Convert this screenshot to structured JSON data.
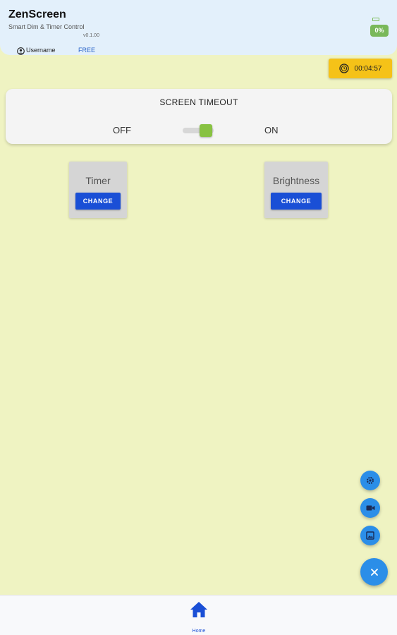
{
  "header": {
    "app_title": "ZenScreen",
    "subtitle": "Smart Dim & Timer Control",
    "version": "v0.1.00",
    "battery_percent": "0%",
    "username": "Username",
    "plan": "FREE"
  },
  "timer_chip": {
    "time": "00:04:57",
    "icon": "coin-icon"
  },
  "screen_timeout": {
    "title": "SCREEN TIMEOUT",
    "off_label": "OFF",
    "on_label": "ON",
    "enabled": true
  },
  "tiles": {
    "timer": {
      "label": "Timer",
      "button": "CHANGE"
    },
    "brightness": {
      "label": "Brightness",
      "button": "CHANGE"
    }
  },
  "fab": {
    "items": [
      "gear-icon",
      "video-camera-icon",
      "image-icon"
    ],
    "main_icon": "close-icon"
  },
  "bottom_nav": {
    "home_label": "Home"
  },
  "colors": {
    "background": "#eff3c2",
    "header": "#e3f0fb",
    "accent_blue": "#1a4fd6",
    "fab_blue": "#2b8ee8",
    "timer_chip": "#f5c218",
    "switch_on": "#88c242",
    "battery": "#79b85a"
  }
}
